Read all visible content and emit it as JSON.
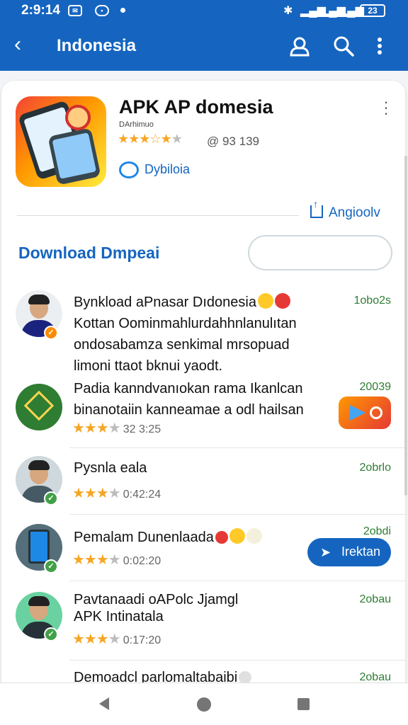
{
  "status": {
    "time": "2:9:14",
    "battery": "23"
  },
  "appbar": {
    "back": "‹",
    "title": "Indonesia"
  },
  "app": {
    "title": "APK AP domesia",
    "developer": "DArhimuo",
    "rating_value": 3.5,
    "rating_count": "@ 93 139",
    "dev_link": "Dybiloia",
    "share_label": "Angioolv"
  },
  "download": {
    "title": "Download Dmpeai",
    "input_placeholder": ""
  },
  "reviews": [
    {
      "title": "Bynkload aPnasar Dıdonesia",
      "lines": [
        "Kottan Oominmahlurdahhnlanulıtan",
        "ondosabamza senkimal mrsopuad",
        "limoni ttaot bknui yaodt."
      ],
      "date": "1obo2s"
    },
    {
      "title": "",
      "lines": [
        "Padia kanndvanıokan rama Ikanlcan",
        "binanotaiin kanneamae a odl hailsan"
      ],
      "rating": 3.5,
      "time": "32 3:25",
      "date": "20039"
    },
    {
      "title": "Pysnla eala",
      "rating": 3.5,
      "time": "0:42:24",
      "date": "2obrlo"
    },
    {
      "title": "Pemalam Dunenlaada",
      "rating": 3.5,
      "time": "0:02:20",
      "date": "2obdi"
    },
    {
      "title": "Pavtanaadi oAPolc Jjamgl",
      "subtitle": "APK Intinatala",
      "rating": 3.5,
      "time": "0:17:20",
      "date": "2obau"
    },
    {
      "title": "Demoadcl parlomaltabaibi",
      "date": "2obau"
    }
  ],
  "action_button": {
    "label": "Irektan"
  },
  "colors": {
    "primary": "#1565c0",
    "date_green": "#2e7d32",
    "star": "#f5a623"
  }
}
